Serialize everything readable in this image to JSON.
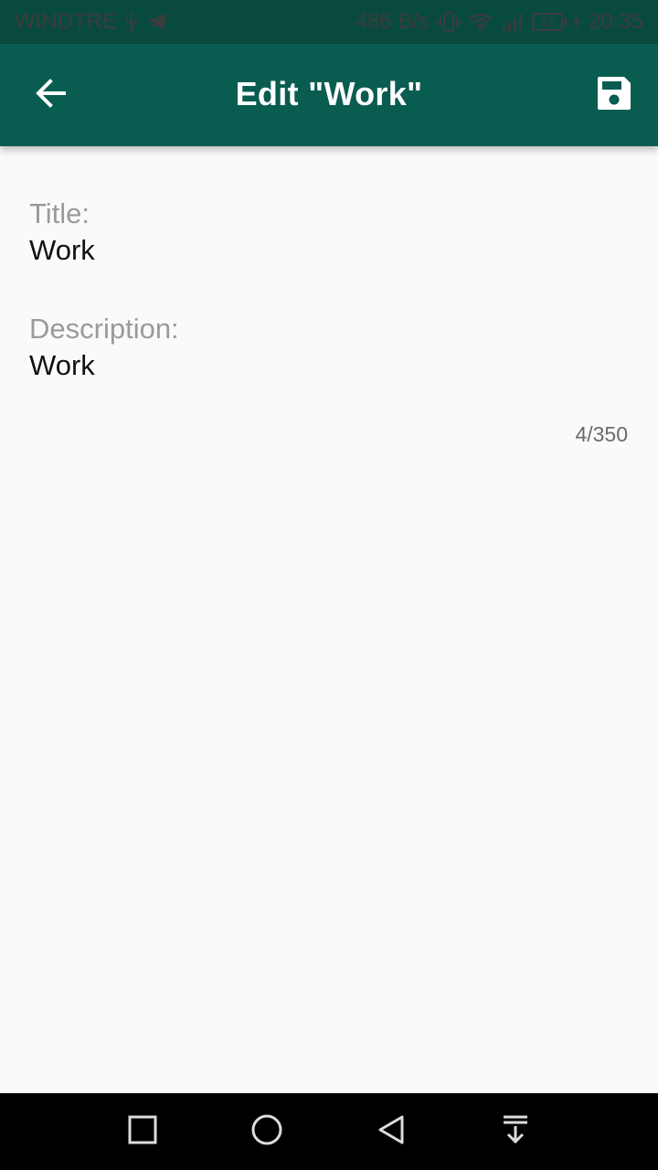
{
  "status_bar": {
    "carrier": "WINDTRE",
    "net_speed": "486 B/s",
    "battery_level": "37",
    "time": "20:35",
    "icons": [
      "usb-icon",
      "telegram-icon",
      "vibrate-icon",
      "wifi-icon",
      "signal-icon",
      "battery-icon",
      "charging-icon"
    ]
  },
  "app_bar": {
    "title": "Edit \"Work\"",
    "back_icon": "arrow-back-icon",
    "save_icon": "floppy-save-icon",
    "color": "#095c50"
  },
  "form": {
    "title_label": "Title:",
    "title_value": "Work",
    "description_label": "Description:",
    "description_value": "Work",
    "char_counter": "4/350"
  },
  "nav_bar": {
    "buttons": [
      "recents-square-icon",
      "home-circle-icon",
      "back-triangle-icon",
      "notification-pull-down-icon"
    ]
  }
}
